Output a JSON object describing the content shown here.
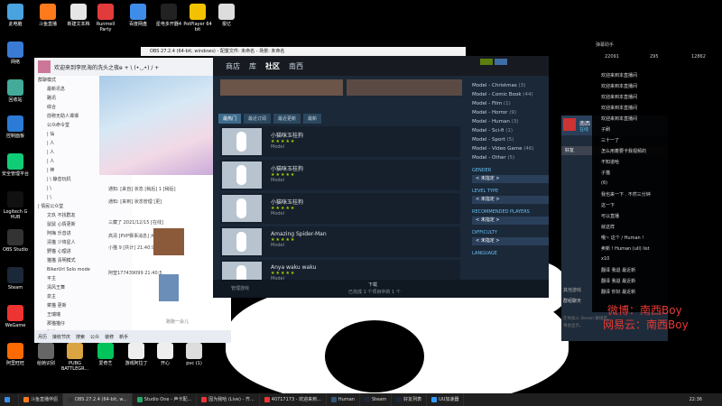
{
  "desktop_icons": [
    {
      "label": "此电脑",
      "color": "#4aa3df"
    },
    {
      "label": "斗鱼直播",
      "color": "#ff7a1a"
    },
    {
      "label": "新建文本档",
      "color": "#e6e6e6"
    },
    {
      "label": "Runmell Party",
      "color": "#e23b3b"
    },
    {
      "label": "百度网盘",
      "color": "#3e8ee9"
    },
    {
      "label": "星电多开器4",
      "color": "#222"
    },
    {
      "label": "PotPlayer 64 bit",
      "color": "#f2c200"
    },
    {
      "label": "报亿",
      "color": "#ddd"
    },
    {
      "label": "网络",
      "color": "#3a7bd5"
    },
    {
      "label": "回收站",
      "color": "#4a9"
    },
    {
      "label": "控制面板",
      "color": "#2b7bd6"
    },
    {
      "label": "安全管理平台",
      "color": "#1c7"
    },
    {
      "label": "Logitech G HUB",
      "color": "#111"
    },
    {
      "label": "OBS Studio",
      "color": "#333"
    },
    {
      "label": "Steam",
      "color": "#1b2838"
    },
    {
      "label": "WeGame",
      "color": "#e33"
    },
    {
      "label": "阿里旺旺",
      "color": "#ff6a00"
    },
    {
      "label": "给她识别",
      "color": "#666"
    },
    {
      "label": "PUBG BATTLEGR...",
      "color": "#d9a441"
    },
    {
      "label": "爱奇艺",
      "color": "#00c35a"
    },
    {
      "label": "游戏阿拉丁",
      "color": "#eee"
    },
    {
      "label": "开心",
      "color": "#eee"
    },
    {
      "label": "pvc (1)",
      "color": "#ddd"
    }
  ],
  "qq": {
    "title": "欢迎来到李民海的洗头之夜ө + \\ (•◡•) / +",
    "tabs": [
      "我的",
      "好友",
      "群聊"
    ],
    "groups": [
      {
        "label": "群聊模式",
        "is_head": true
      },
      {
        "label": "最新讯息"
      },
      {
        "label": "路讯"
      },
      {
        "label": "综合"
      },
      {
        "label": "前称无助人谭谭"
      },
      {
        "label": "公众命令堂"
      },
      {
        "label": "|             仙"
      },
      {
        "label": "|             人"
      },
      {
        "label": "|             人"
      },
      {
        "label": "|             人"
      },
      {
        "label": "|             神"
      },
      {
        "label": "|    \\     静音玩机"
      },
      {
        "label": "|             \\"
      },
      {
        "label": "|             \\"
      },
      {
        "label": "|    情民公众堂",
        "is_head": true
      },
      {
        "label": "文玖   不找群友"
      },
      {
        "label": "鼠鼠    心情更新"
      },
      {
        "label": "阿梅    乐音进"
      },
      {
        "label": "清猫    少将星人"
      },
      {
        "label": "野猫    心理进"
      },
      {
        "label": "猫猫    清明模式"
      },
      {
        "label": "BikerUrl  Solo mode"
      },
      {
        "label": "平主"
      },
      {
        "label": "清风王舞"
      },
      {
        "label": "泉主"
      },
      {
        "label": "菜猫    更新"
      },
      {
        "label": "王瑞瑞"
      },
      {
        "label": "那猫猫仔"
      },
      {
        "label": "辟猫"
      }
    ],
    "feed": [
      "通知: [来自] 状态 [稍后] 1 [稍后]",
      "通知: [来到] 状态管理 [更]",
      "三藏了 2021/12/15 [在线]",
      "高清  [PVP赛事消息] 大学生 [在线]",
      "小猫 9 [共计] 21:40:9",
      "阿莹177439099 21:40:5"
    ],
    "input_placeholder": "跑跑一会儿",
    "bottom_items": [
      "月历",
      "接收节庆",
      "搜索",
      "公众",
      "装修",
      "新手"
    ]
  },
  "obs": {
    "title": "OBS 27.2.4 (64-bit, windows) - 配置文件: 未命名 - 场景: 未命名"
  },
  "steam": {
    "nav": [
      "商店",
      "库",
      "社区",
      "南西"
    ],
    "nav_active_index": 2,
    "tabs": [
      "最热门",
      "最近订阅",
      "最近更新",
      "最新"
    ],
    "items": [
      {
        "title": "小猫咪玉桂狗",
        "stars": "★★★★★",
        "type": "Model"
      },
      {
        "title": "小猫咪玉桂狗",
        "stars": "★★★★★",
        "type": "Model"
      },
      {
        "title": "小猫咪玉桂狗",
        "stars": "★★★★★",
        "type": "Model"
      },
      {
        "title": "Amazing Spider-Man",
        "stars": "★★★★★",
        "type": "Model"
      },
      {
        "title": "Anya waku waku",
        "stars": "★★★★★",
        "type": "Model"
      }
    ],
    "categories": [
      {
        "name": "Model - Christmas",
        "count": "(3)"
      },
      {
        "name": "Model - Comic Book",
        "count": "(44)"
      },
      {
        "name": "Model - Film",
        "count": "(1)"
      },
      {
        "name": "Model - Horror",
        "count": "(9)"
      },
      {
        "name": "Model - Human",
        "count": "(3)"
      },
      {
        "name": "Model - Sci-fi",
        "count": "(1)"
      },
      {
        "name": "Model - Sport",
        "count": "(5)"
      },
      {
        "name": "Model - Video Game",
        "count": "(46)"
      },
      {
        "name": "Model - Other",
        "count": "(5)"
      }
    ],
    "filters": [
      {
        "label": "GENDER",
        "value": "< 未指定 >"
      },
      {
        "label": "LEVEL TYPE",
        "value": "< 未指定 >"
      },
      {
        "label": "RECOMMENDED PLAYERS",
        "value": "< 未指定 >"
      },
      {
        "label": "DIFFICULTY",
        "value": "< 未指定 >"
      },
      {
        "label": "LANGUAGE",
        "value": ""
      }
    ],
    "footer_left": "管理游戏",
    "footer_center": "下载",
    "footer_sub": "已完成 1 个项目中的 1 个"
  },
  "friends": {
    "name": "南西",
    "status": "在线",
    "search_label": "好友",
    "label_other": "其他游戏",
    "group_chat": "群组聊天"
  },
  "panel": {
    "header": "弹幕助手",
    "stat1": "22091",
    "stat2": "295",
    "stat3": "12862",
    "messages": [
      "欢迎来到本直播间",
      "欢迎来到本直播间",
      "欢迎来到本直播间",
      "欢迎来到本直播间",
      "欢迎来到本直播间",
      "子刷",
      "三十一了",
      "怎么用着要卡我视频的",
      "不知道哈",
      "子猫",
      "(6)",
      "我也来一下 . 不然三分钟",
      "这一下",
      "可以直播",
      "就这样",
      "哦~ 这个 / Human !",
      "卖新 ! Human (ull) list",
      "x10",
      "翻译 我退 最近新",
      "翻译 我退 最近新",
      "翻译 你好 最近新"
    ],
    "watermark_1": "微博：南西Boy",
    "watermark_2": "网易云：南西Boy",
    "steam_notice": "在你加入 Steam 群组后，",
    "steam_notice2": "将会显示。"
  },
  "taskbar": {
    "items": [
      {
        "label": "斗鱼直播伴侣",
        "color": "#ff7a1a"
      },
      {
        "label": "OBS 27.2.4 (64-bit, w...",
        "color": "#333"
      },
      {
        "label": "Studio One - 声卡配...",
        "color": "#2a6"
      },
      {
        "label": "因为我哈 (Live) - 齐...",
        "color": "#e33"
      },
      {
        "label": "40717173 - 欢迎来到...",
        "color": "#e33"
      },
      {
        "label": "Human",
        "color": "#357"
      },
      {
        "label": "Steam",
        "color": "#1b2838"
      },
      {
        "label": "好友列表",
        "color": "#1b2838"
      },
      {
        "label": "UU加速器",
        "color": "#39f"
      }
    ],
    "time": "22:36"
  }
}
